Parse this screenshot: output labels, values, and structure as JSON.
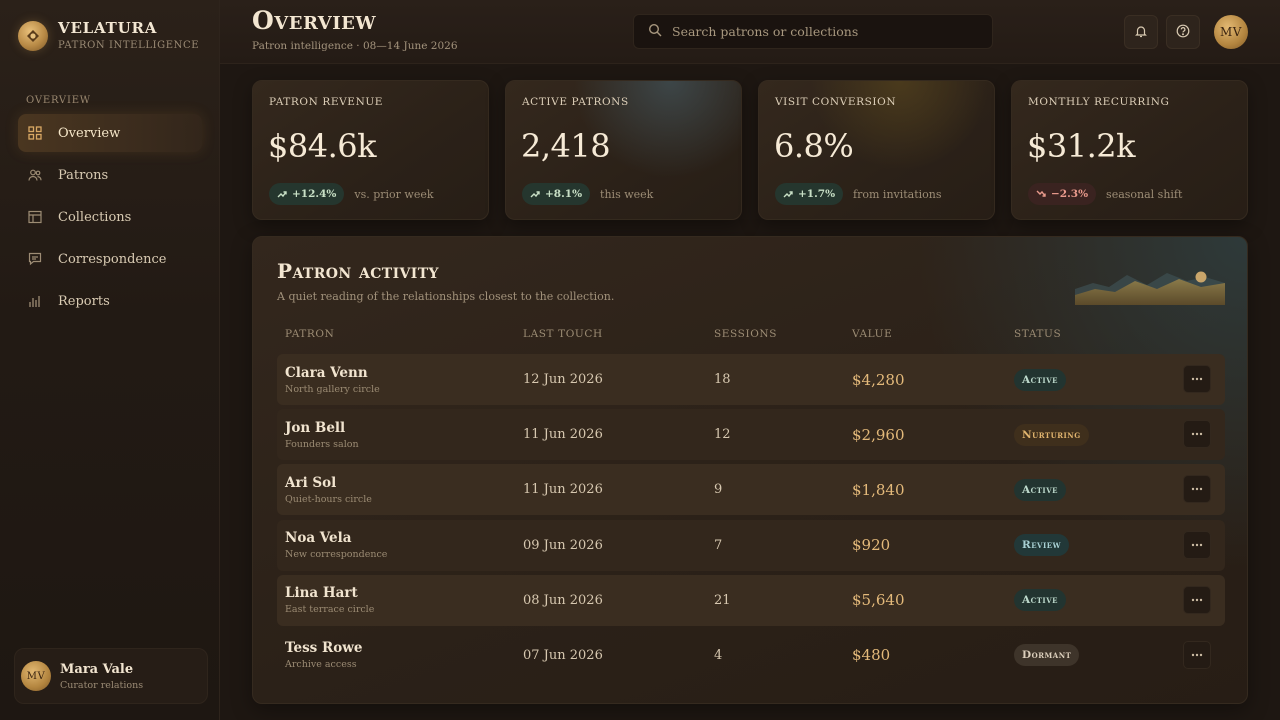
{
  "brand": {
    "name": "VELATURA",
    "subtitle": "PATRON INTELLIGENCE",
    "icon": "brand-seal-icon"
  },
  "sidebar": {
    "section_label": "OVERVIEW",
    "items": [
      {
        "label": "Overview",
        "icon": "grid-icon",
        "active": true
      },
      {
        "label": "Patrons",
        "icon": "users-icon",
        "active": false
      },
      {
        "label": "Collections",
        "icon": "table-icon",
        "active": false
      },
      {
        "label": "Correspondence",
        "icon": "message-icon",
        "active": false
      },
      {
        "label": "Reports",
        "icon": "bar-chart-icon",
        "active": false
      }
    ],
    "user": {
      "initials": "MV",
      "name": "Mara Vale",
      "role": "Curator relations"
    }
  },
  "header": {
    "title": "Overview",
    "subtitle": "Patron intelligence · 08—14 June 2026",
    "search_placeholder": "Search patrons or collections",
    "avatar_initials": "MV"
  },
  "kpis": [
    {
      "label": "PATRON REVENUE",
      "value": "$84.6k",
      "delta": "+12.4%",
      "direction": "up",
      "note": "vs. prior week"
    },
    {
      "label": "ACTIVE PATRONS",
      "value": "2,418",
      "delta": "+8.1%",
      "direction": "up",
      "note": "this week"
    },
    {
      "label": "VISIT CONVERSION",
      "value": "6.8%",
      "delta": "+1.7%",
      "direction": "up",
      "note": "from invitations"
    },
    {
      "label": "MONTHLY RECURRING",
      "value": "$31.2k",
      "delta": "−2.3%",
      "direction": "down",
      "note": "seasonal shift"
    }
  ],
  "activity": {
    "title": "Patron activity",
    "subtitle": "A quiet reading of the relationships closest to the collection.",
    "columns": [
      "PATRON",
      "LAST TOUCH",
      "SESSIONS",
      "VALUE",
      "STATUS"
    ],
    "rows": [
      {
        "name": "Clara Venn",
        "circle": "North gallery circle",
        "last_touch": "12 Jun 2026",
        "sessions": "18",
        "value": "$4,280",
        "status": "Active"
      },
      {
        "name": "Jon Bell",
        "circle": "Founders salon",
        "last_touch": "11 Jun 2026",
        "sessions": "12",
        "value": "$2,960",
        "status": "Nurturing"
      },
      {
        "name": "Ari Sol",
        "circle": "Quiet-hours circle",
        "last_touch": "11 Jun 2026",
        "sessions": "9",
        "value": "$1,840",
        "status": "Active"
      },
      {
        "name": "Noa Vela",
        "circle": "New correspondence",
        "last_touch": "09 Jun 2026",
        "sessions": "7",
        "value": "$920",
        "status": "Review"
      },
      {
        "name": "Lina Hart",
        "circle": "East terrace circle",
        "last_touch": "08 Jun 2026",
        "sessions": "21",
        "value": "$5,640",
        "status": "Active"
      },
      {
        "name": "Tess Rowe",
        "circle": "Archive access",
        "last_touch": "07 Jun 2026",
        "sessions": "4",
        "value": "$480",
        "status": "Dormant"
      }
    ]
  },
  "colors": {
    "accent_gold": "#e3b97a",
    "positive": "#c9e0c6",
    "negative": "#e99a8c",
    "background": "#1e1712"
  }
}
